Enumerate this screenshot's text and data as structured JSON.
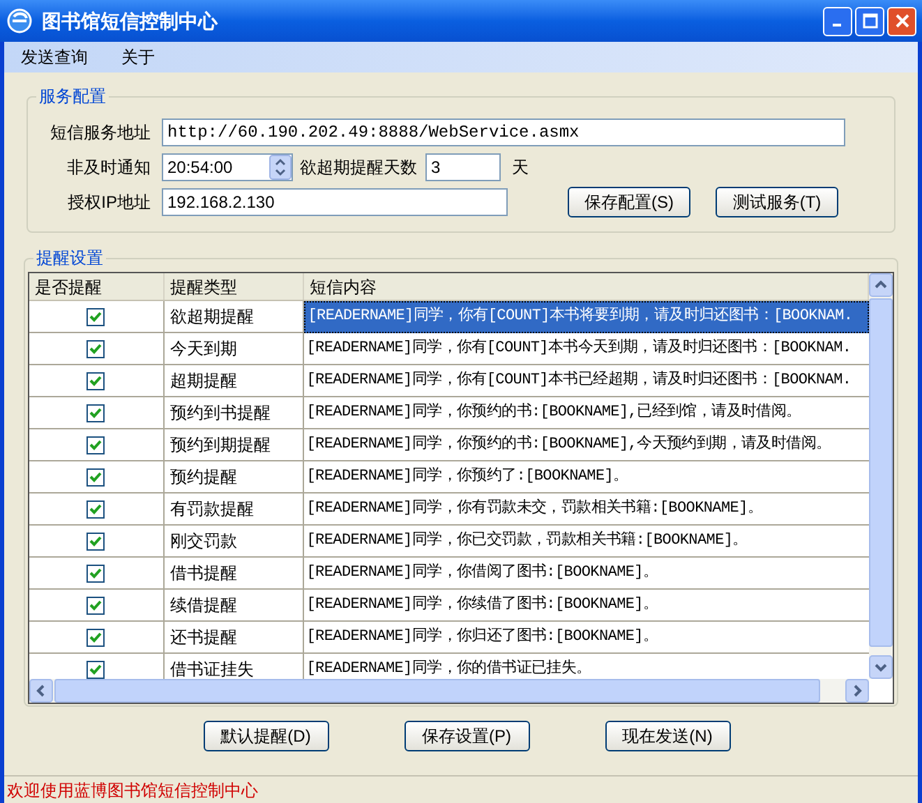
{
  "window": {
    "title": "图书馆短信控制中心"
  },
  "menu": [
    "发送查询",
    "关于"
  ],
  "service_config": {
    "title": "服务配置",
    "sms_url": {
      "label": "短信服务地址",
      "value": "http://60.190.202.49:8888/WebService.asmx"
    },
    "late_notice": {
      "label": "非及时通知",
      "value": "20:54:00"
    },
    "days_before": {
      "label": "欲超期提醒天数",
      "value": "3",
      "unit": "天"
    },
    "ip": {
      "label": "授权IP地址",
      "value": "192.168.2.130"
    },
    "buttons": [
      "保存配置(S)",
      "测试服务(T)"
    ]
  },
  "reminder_settings": {
    "title": "提醒设置",
    "table": {
      "columns": [
        "是否提醒",
        "提醒类型",
        "短信内容"
      ],
      "rows": [
        {
          "checked": true,
          "type": "欲超期提醒",
          "content": "[READERNAME]同学，你有[COUNT]本书将要到期，请及时归还图书：[BOOKNAM.",
          "selected": true
        },
        {
          "checked": true,
          "type": "今天到期",
          "content": "[READERNAME]同学，你有[COUNT]本书今天到期，请及时归还图书：[BOOKNAM.",
          "selected": false
        },
        {
          "checked": true,
          "type": "超期提醒",
          "content": "[READERNAME]同学，你有[COUNT]本书已经超期，请及时归还图书：[BOOKNAM.",
          "selected": false
        },
        {
          "checked": true,
          "type": "预约到书提醒",
          "content": "[READERNAME]同学，你预约的书:[BOOKNAME],已经到馆，请及时借阅。",
          "selected": false
        },
        {
          "checked": true,
          "type": "预约到期提醒",
          "content": "[READERNAME]同学，你预约的书:[BOOKNAME],今天预约到期，请及时借阅。",
          "selected": false
        },
        {
          "checked": true,
          "type": "预约提醒",
          "content": "[READERNAME]同学，你预约了:[BOOKNAME]。",
          "selected": false
        },
        {
          "checked": true,
          "type": "有罚款提醒",
          "content": "[READERNAME]同学，你有罚款未交，罚款相关书籍:[BOOKNAME]。",
          "selected": false
        },
        {
          "checked": true,
          "type": "刚交罚款",
          "content": "[READERNAME]同学，你已交罚款，罚款相关书籍:[BOOKNAME]。",
          "selected": false
        },
        {
          "checked": true,
          "type": "借书提醒",
          "content": "[READERNAME]同学，你借阅了图书:[BOOKNAME]。",
          "selected": false
        },
        {
          "checked": true,
          "type": "续借提醒",
          "content": "[READERNAME]同学，你续借了图书:[BOOKNAME]。",
          "selected": false
        },
        {
          "checked": true,
          "type": "还书提醒",
          "content": "[READERNAME]同学，你归还了图书:[BOOKNAME]。",
          "selected": false
        },
        {
          "checked": true,
          "type": "借书证挂失",
          "content": "[READERNAME]同学，你的借书证已挂失。",
          "selected": false
        }
      ]
    },
    "buttons": [
      "默认提醒(D)",
      "保存设置(P)",
      "现在发送(N)"
    ]
  },
  "status_bar": "欢迎使用蓝博图书馆短信控制中心"
}
